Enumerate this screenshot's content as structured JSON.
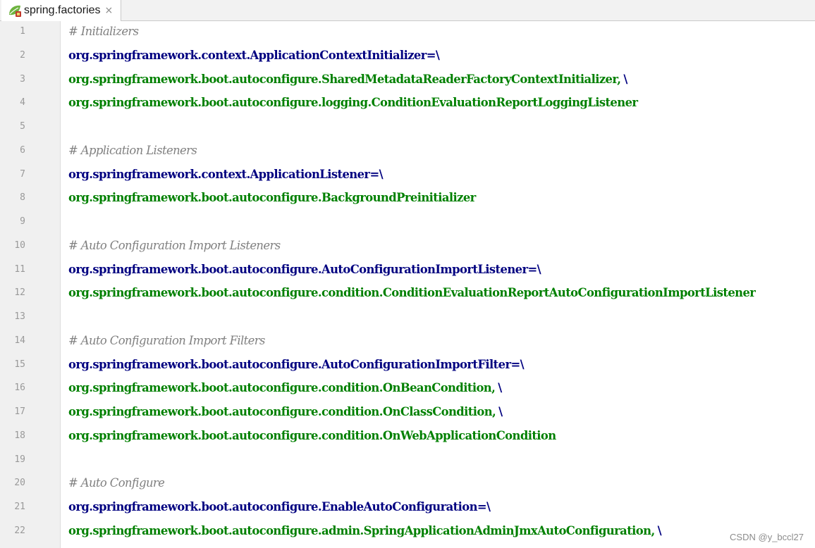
{
  "tab": {
    "icon": "spring-leaf-icon",
    "label": "spring.factories",
    "close": "×"
  },
  "colors": {
    "comment": "#808080",
    "key": "#000080",
    "value": "#008000",
    "gutter": "#f0f0f0"
  },
  "lines": [
    {
      "num": "1",
      "type": "comment",
      "text": "# Initializers"
    },
    {
      "num": "2",
      "type": "key",
      "text": "org.springframework.context.ApplicationContextInitializer=\\"
    },
    {
      "num": "3",
      "type": "value",
      "text": "org.springframework.boot.autoconfigure.SharedMetadataReaderFactoryContextInitializer,",
      "cont": "\\"
    },
    {
      "num": "4",
      "type": "value",
      "text": "org.springframework.boot.autoconfigure.logging.ConditionEvaluationReportLoggingListener"
    },
    {
      "num": "5",
      "type": "blank",
      "text": ""
    },
    {
      "num": "6",
      "type": "comment",
      "text": "# Application Listeners"
    },
    {
      "num": "7",
      "type": "key",
      "text": "org.springframework.context.ApplicationListener=\\"
    },
    {
      "num": "8",
      "type": "value",
      "text": "org.springframework.boot.autoconfigure.BackgroundPreinitializer"
    },
    {
      "num": "9",
      "type": "blank",
      "text": ""
    },
    {
      "num": "10",
      "type": "comment",
      "text": "# Auto Configuration Import Listeners"
    },
    {
      "num": "11",
      "type": "key",
      "text": "org.springframework.boot.autoconfigure.AutoConfigurationImportListener=\\"
    },
    {
      "num": "12",
      "type": "value",
      "text": "org.springframework.boot.autoconfigure.condition.ConditionEvaluationReportAutoConfigurationImportListener"
    },
    {
      "num": "13",
      "type": "blank",
      "text": ""
    },
    {
      "num": "14",
      "type": "comment",
      "text": "# Auto Configuration Import Filters"
    },
    {
      "num": "15",
      "type": "key",
      "text": "org.springframework.boot.autoconfigure.AutoConfigurationImportFilter=\\"
    },
    {
      "num": "16",
      "type": "value",
      "text": "org.springframework.boot.autoconfigure.condition.OnBeanCondition,",
      "cont": "\\"
    },
    {
      "num": "17",
      "type": "value",
      "text": "org.springframework.boot.autoconfigure.condition.OnClassCondition,",
      "cont": "\\"
    },
    {
      "num": "18",
      "type": "value",
      "text": "org.springframework.boot.autoconfigure.condition.OnWebApplicationCondition"
    },
    {
      "num": "19",
      "type": "blank",
      "text": ""
    },
    {
      "num": "20",
      "type": "comment",
      "text": "# Auto Configure"
    },
    {
      "num": "21",
      "type": "key",
      "text": "org.springframework.boot.autoconfigure.EnableAutoConfiguration=\\"
    },
    {
      "num": "22",
      "type": "value",
      "text": "org.springframework.boot.autoconfigure.admin.SpringApplicationAdminJmxAutoConfiguration,",
      "cont": "\\"
    }
  ],
  "watermark": "CSDN @y_bccl27"
}
